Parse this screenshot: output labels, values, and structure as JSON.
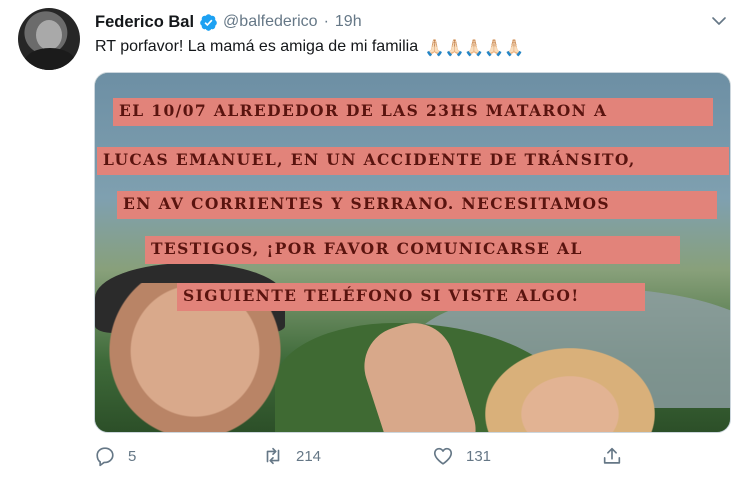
{
  "tweet": {
    "author_name": "Federico Bal",
    "author_handle": "@balfederico",
    "separator": "·",
    "time": "19h",
    "text": "RT porfavor! La mamá es amiga de mi familia",
    "emoji": "🙏🏻🙏🏻🙏🏻🙏🏻🙏🏻",
    "media_text_lines": [
      "EL 10/07 ALREDEDOR DE LAS 23HS MATARON A",
      "LUCAS EMANUEL, EN UN ACCIDENTE DE TRÁNSITO,",
      "EN AV CORRIENTES Y SERRANO. NECESITAMOS",
      "TESTIGOS, ¡POR FAVOR COMUNICARSE AL",
      "SIGUIENTE TELÉFONO SI VISTE ALGO!"
    ],
    "reply_count": "5",
    "retweet_count": "214",
    "like_count": "131"
  },
  "icons": {
    "verified": "verified-badge-icon",
    "caret": "chevron-down-icon",
    "reply": "reply-icon",
    "retweet": "retweet-icon",
    "like": "heart-icon",
    "share": "share-icon"
  },
  "colors": {
    "verified_blue": "#1da1f2",
    "muted_gray": "#657786",
    "banner_bg": "#e2837a",
    "banner_text": "#5a140f"
  }
}
